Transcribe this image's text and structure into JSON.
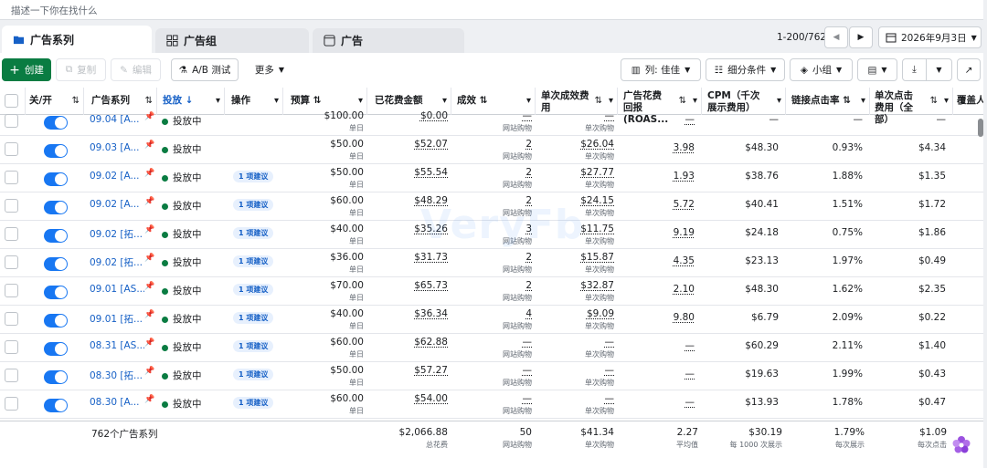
{
  "search": {
    "placeholder": "描述一下你在找什么"
  },
  "tabs": [
    {
      "label": "广告系列",
      "icon": "folder-icon"
    },
    {
      "label": "广告组",
      "icon": "grid-icon"
    },
    {
      "label": "广告",
      "icon": "square-icon"
    }
  ],
  "pagination": {
    "range": "1-200/762",
    "prev": "◀",
    "next": "▶"
  },
  "date": {
    "label": "2026年9月3日"
  },
  "toolbar": {
    "create": "创建",
    "copy": "复制",
    "edit": "编辑",
    "ab_test": "A/B 测试",
    "more": "更多",
    "columns": "列: 佳佳",
    "breakdown": "细分条件",
    "group": "小组"
  },
  "columns": [
    "关/开",
    "广告系列",
    "投放",
    "操作",
    "预算",
    "已花费金额",
    "成效",
    "单次成效费用",
    "广告花费回报 (ROAS...",
    "CPM（千次展示费用）",
    "链接点击率",
    "单次点击费用（全部）",
    "覆盖人数"
  ],
  "rows": [
    {
      "name": "09.04 [A...",
      "status": "投放中",
      "suggest": "",
      "budget": "$100.00",
      "budget_sub": "单日",
      "spend": "$0.00",
      "results": "—",
      "results_sub": "网站购物",
      "cpr": "—",
      "cpr_sub": "单次购物",
      "roas": "—",
      "cpm": "—",
      "ctr": "—",
      "cpc": "—"
    },
    {
      "name": "09.03 [A...",
      "status": "投放中",
      "suggest": "",
      "budget": "$50.00",
      "budget_sub": "单日",
      "spend": "$52.07",
      "results": "2",
      "results_sub": "网站购物",
      "cpr": "$26.04",
      "cpr_sub": "单次购物",
      "roas": "3.98",
      "cpm": "$48.30",
      "ctr": "0.93%",
      "cpc": "$4.34"
    },
    {
      "name": "09.02 [A...",
      "status": "投放中",
      "suggest": "1 项建议",
      "budget": "$50.00",
      "budget_sub": "单日",
      "spend": "$55.54",
      "results": "2",
      "results_sub": "网站购物",
      "cpr": "$27.77",
      "cpr_sub": "单次购物",
      "roas": "1.93",
      "cpm": "$38.76",
      "ctr": "1.88%",
      "cpc": "$1.35"
    },
    {
      "name": "09.02 [A...",
      "status": "投放中",
      "suggest": "1 项建议",
      "budget": "$60.00",
      "budget_sub": "单日",
      "spend": "$48.29",
      "results": "2",
      "results_sub": "网站购物",
      "cpr": "$24.15",
      "cpr_sub": "单次购物",
      "roas": "5.72",
      "cpm": "$40.41",
      "ctr": "1.51%",
      "cpc": "$1.72"
    },
    {
      "name": "09.02 [拓...",
      "status": "投放中",
      "suggest": "1 项建议",
      "budget": "$40.00",
      "budget_sub": "单日",
      "spend": "$35.26",
      "results": "3",
      "results_sub": "网站购物",
      "cpr": "$11.75",
      "cpr_sub": "单次购物",
      "roas": "9.19",
      "cpm": "$24.18",
      "ctr": "0.75%",
      "cpc": "$1.86"
    },
    {
      "name": "09.02 [拓...",
      "status": "投放中",
      "suggest": "1 项建议",
      "budget": "$36.00",
      "budget_sub": "单日",
      "spend": "$31.73",
      "results": "2",
      "results_sub": "网站购物",
      "cpr": "$15.87",
      "cpr_sub": "单次购物",
      "roas": "4.35",
      "cpm": "$23.13",
      "ctr": "1.97%",
      "cpc": "$0.49"
    },
    {
      "name": "09.01 [AS...",
      "status": "投放中",
      "suggest": "1 项建议",
      "budget": "$70.00",
      "budget_sub": "单日",
      "spend": "$65.73",
      "results": "2",
      "results_sub": "网站购物",
      "cpr": "$32.87",
      "cpr_sub": "单次购物",
      "roas": "2.10",
      "cpm": "$48.30",
      "ctr": "1.62%",
      "cpc": "$2.35"
    },
    {
      "name": "09.01 [拓...",
      "status": "投放中",
      "suggest": "1 项建议",
      "budget": "$40.00",
      "budget_sub": "单日",
      "spend": "$36.34",
      "results": "4",
      "results_sub": "网站购物",
      "cpr": "$9.09",
      "cpr_sub": "单次购物",
      "roas": "9.80",
      "cpm": "$6.79",
      "ctr": "2.09%",
      "cpc": "$0.22"
    },
    {
      "name": "08.31 [AS...",
      "status": "投放中",
      "suggest": "1 项建议",
      "budget": "$60.00",
      "budget_sub": "单日",
      "spend": "$62.88",
      "results": "—",
      "results_sub": "网站购物",
      "cpr": "—",
      "cpr_sub": "单次购物",
      "roas": "—",
      "cpm": "$60.29",
      "ctr": "2.11%",
      "cpc": "$1.40"
    },
    {
      "name": "08.30 [拓...",
      "status": "投放中",
      "suggest": "1 项建议",
      "budget": "$50.00",
      "budget_sub": "单日",
      "spend": "$57.27",
      "results": "—",
      "results_sub": "网站购物",
      "cpr": "—",
      "cpr_sub": "单次购物",
      "roas": "—",
      "cpm": "$19.63",
      "ctr": "1.99%",
      "cpc": "$0.43"
    },
    {
      "name": "08.30 [A...",
      "status": "投放中",
      "suggest": "1 项建议",
      "budget": "$60.00",
      "budget_sub": "单日",
      "spend": "$54.00",
      "results": "—",
      "results_sub": "网站购物",
      "cpr": "—",
      "cpr_sub": "单次购物",
      "roas": "—",
      "cpm": "$13.93",
      "ctr": "1.78%",
      "cpc": "$0.47"
    }
  ],
  "footer": {
    "count": "762个广告系列",
    "spend": "$2,066.88",
    "spend_sub": "总花费",
    "results": "50",
    "results_sub": "网站购物",
    "cpr": "$41.34",
    "cpr_sub": "单次购物",
    "roas": "2.27",
    "roas_sub": "平均值",
    "cpm": "$30.19",
    "cpm_sub": "每 1000 次展示",
    "ctr": "1.79%",
    "ctr_sub": "每次展示",
    "cpc": "$1.09",
    "cpc_sub": "每次点击"
  },
  "watermark": "VeryFb",
  "colors": {
    "accent": "#1877f2",
    "green": "#0a7c42",
    "link": "#1660c6"
  }
}
